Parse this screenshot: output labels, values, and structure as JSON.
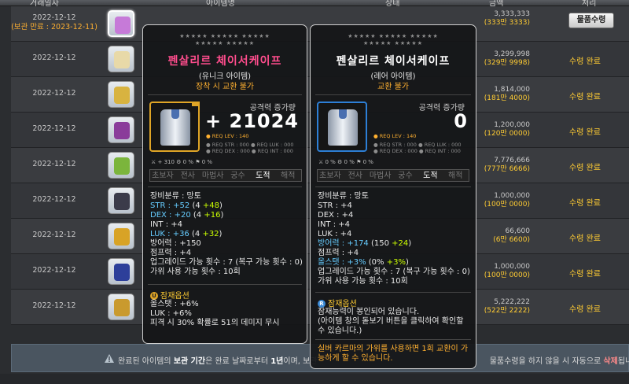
{
  "header": {
    "cols": [
      "거래일자",
      "아이템명",
      "상태",
      "금액",
      "처리"
    ]
  },
  "rows": [
    {
      "date": "2022-12-12",
      "expire": "(보관 만료 : 2023-12-11)",
      "icon": "cape-icon",
      "icon_color": "#c67ad8",
      "price": "3,333,333",
      "price_sub": "(333만 3333)",
      "action": "물품수령",
      "action_type": "button"
    },
    {
      "date": "2022-12-12",
      "icon": "scroll-icon",
      "icon_color": "#e8d9a8",
      "price": "3,299,998",
      "price_sub": "(329만 9998)",
      "action": "수령 완료",
      "action_type": "status"
    },
    {
      "date": "2022-12-12",
      "icon": "coin-box-icon",
      "icon_color": "#d8b340",
      "price": "1,814,000",
      "price_sub": "(181만 4000)",
      "action": "수령 완료",
      "action_type": "status"
    },
    {
      "date": "2022-12-12",
      "icon": "helmet-icon",
      "icon_color": "#8a3c9a",
      "price": "1,200,000",
      "price_sub": "(120만 0000)",
      "action": "수령 완료",
      "action_type": "status"
    },
    {
      "date": "2022-12-12",
      "icon": "green-cape-icon",
      "icon_color": "#7bb53c",
      "price": "7,776,666",
      "price_sub": "(777만 6666)",
      "action": "수령 완료",
      "action_type": "status"
    },
    {
      "date": "2022-12-12",
      "icon": "pouch-icon",
      "icon_color": "#3b3b4a",
      "price": "1,000,000",
      "price_sub": "(100만 0000)",
      "action": "수령 완료",
      "action_type": "status"
    },
    {
      "date": "2022-12-12",
      "icon": "armor-icon",
      "icon_color": "#d8a326",
      "price": "66,600",
      "price_sub": "(6만 6600)",
      "action": "수령 완료",
      "action_type": "status"
    },
    {
      "date": "2022-12-12",
      "icon": "shoes-icon",
      "icon_color": "#2d3f9a",
      "price": "1,000,000",
      "price_sub": "(100만 0000)",
      "action": "수령 완료",
      "action_type": "status"
    },
    {
      "date": "2022-12-12",
      "icon": "glove-icon",
      "icon_color": "#c99a2e",
      "price": "5,222,222",
      "price_sub": "(522만 2222)",
      "action": "수령 완료",
      "action_type": "status"
    }
  ],
  "notice": {
    "text_a": "완료된 아이템의 ",
    "text_b": "보관 기간",
    "text_c": "은 완료 날짜로부터 ",
    "text_d": "1년",
    "text_e": "이며, 보관",
    "text_f": "     물품수령을 하지 않을 시 자동으로 ",
    "text_g": "삭제",
    "text_h": "됩니다."
  },
  "tooltip_left": {
    "stars": "★★★★★ ★★★★★ ★★★★★",
    "stars2": "★★★★★ ★★★★★",
    "name": "펜살리르 체이서케이프",
    "grade": "(유니크 아이템)",
    "trade": "장착 시 교환 불가",
    "atk_label": "공격력 증가량",
    "atk_value": "+ 21024",
    "req_lev": "● REQ LEV : 140",
    "req_row1": "● REQ STR : 000   ● REQ LUK : 000",
    "req_row2": "● REQ DEX : 000   ● REQ INT : 000",
    "mini": "⚔  + 310  ⚙    0 %  ⚑    0 %",
    "jobs": [
      "초보자",
      "전사",
      "마법사",
      "궁수",
      "도적",
      "해적"
    ],
    "active_job": 4,
    "stats": [
      {
        "label": "장비분류 : 망토"
      },
      {
        "label": "STR : ",
        "v": "+52",
        "paren_a": "(4 ",
        "paren_b": "+48",
        "paren_c": ")"
      },
      {
        "label": "DEX : ",
        "v": "+20",
        "paren_a": "(4 ",
        "paren_b": "+16",
        "paren_c": ")"
      },
      {
        "label": "INT : +4"
      },
      {
        "label": "LUK : ",
        "v": "+36",
        "paren_a": "(4 ",
        "paren_b": "+32",
        "paren_c": ")"
      },
      {
        "label": "방어력 : +150"
      },
      {
        "label": "점프력 : +4"
      },
      {
        "label": "업그레이드 가능 횟수 : 7 (복구 가능 횟수 : 0)"
      },
      {
        "label": "가위 사용 가능 횟수 : 10회"
      }
    ],
    "pot_label": "잠재옵션",
    "pot_lines": [
      "올스탯 : +6%",
      "LUK : +6%",
      "피격 시 30% 확률로 51의 데미지 무시"
    ]
  },
  "tooltip_right": {
    "stars": "★★★★★ ★★★★★ ★★★★★",
    "stars2": "★★★★★ ★★★★★",
    "name": "펜살리르 체이서케이프",
    "grade": "(레어 아이템)",
    "trade": "교환 불가",
    "atk_label": "공격력 증가량",
    "atk_value": "0",
    "req_lev": "● REQ LEV : 140",
    "req_row1": "● REQ STR : 000   ● REQ LUK : 000",
    "req_row2": "● REQ DEX : 000   ● REQ INT : 000",
    "mini": "⚔    0 %  ⚙    0 %  ⚑    0 %",
    "jobs": [
      "초보자",
      "전사",
      "마법사",
      "궁수",
      "도적",
      "해적"
    ],
    "active_job": 4,
    "stats": [
      {
        "label": "장비분류 : 망토"
      },
      {
        "label": "STR : +4"
      },
      {
        "label": "DEX : +4"
      },
      {
        "label": "INT : +4"
      },
      {
        "label": "LUK : +4"
      },
      {
        "label": "방어력 : ",
        "v": "+174",
        "paren_a": "(150 ",
        "paren_b": "+24",
        "paren_c": ")"
      },
      {
        "label": "점프력 : +4"
      },
      {
        "label": "올스탯 : ",
        "v": "+3%",
        "paren_a": "(0% ",
        "paren_b": "+3%",
        "paren_c": ")"
      },
      {
        "label": "업그레이드 가능 횟수 : 7 (복구 가능 횟수 : 0)"
      },
      {
        "label": "가위 사용 가능 횟수 : 10회"
      }
    ],
    "pot_label": "잠재옵션",
    "pot_lines": [
      "잠재능력이 봉인되어 있습니다.",
      "(아이템 창의 돋보기 버튼을 클릭하여 확인할",
      "수 있습니다.)"
    ],
    "note": "실버 카르마의 가위를 사용하면 1회 교환이 가능하게 할 수 있습니다."
  }
}
